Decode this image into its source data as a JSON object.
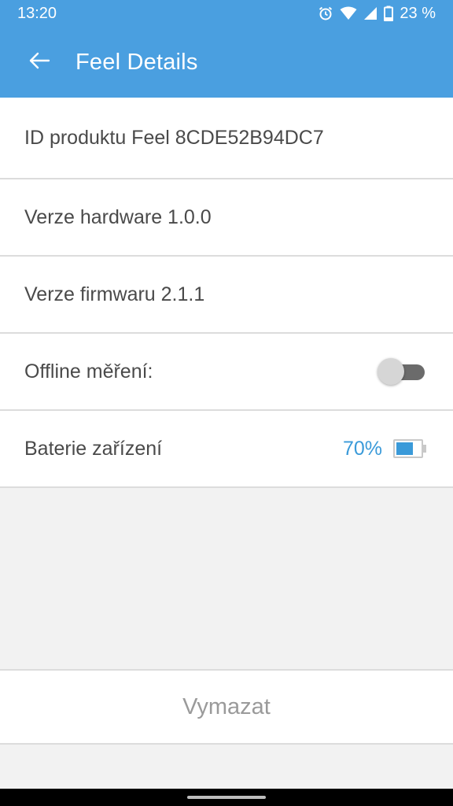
{
  "statusbar": {
    "time": "13:20",
    "battery": "23 %",
    "icons": [
      "alarm-icon",
      "wifi-icon",
      "cell-signal-icon",
      "battery-icon"
    ]
  },
  "appbar": {
    "title": "Feel Details",
    "back_icon": "arrow-left-icon"
  },
  "details": {
    "product_id": "ID produktu Feel 8CDE52B94DC7",
    "hardware": "Verze hardware 1.0.0",
    "firmware": "Verze firmwaru 2.1.1",
    "offline_label": "Offline měření:",
    "offline_enabled": false,
    "battery_label": "Baterie zařízení",
    "battery_value": "70%",
    "battery_level": 0.7
  },
  "actions": {
    "delete_label": "Vymazat"
  },
  "colors": {
    "primary": "#4a9fe0",
    "accent": "#3a9ad9"
  }
}
